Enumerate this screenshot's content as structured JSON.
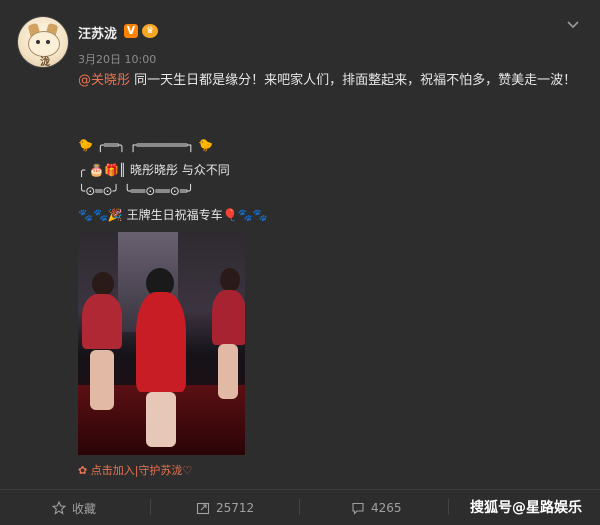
{
  "post": {
    "author": "汪苏泷",
    "date_time": "3月20日 10:00",
    "mention": "@关晓彤",
    "text": " 同一天生日都是缘分！来吧家人们，排面整起来，祝福不怕多，赞美走一波！",
    "deco_line1": "🐤 ╭══╮ ┌═══════┐ 🐤",
    "deco_line2": "╭ 🎂🎁║   晓彤晓彤 与众不同",
    "deco_line3": "╰⊙═⊙╯ ╰══⊙══⊙═╯",
    "deco_line4": "🐾🐾🎉 王牌生日祝福专车🎈🐾🐾",
    "join_link": "✿ 点击加入|守护苏泷♡"
  },
  "footer": {
    "favorite_label": "收藏",
    "repost_count": "25712",
    "comment_count": "4265",
    "watermark": "搜狐号@星路娱乐"
  }
}
